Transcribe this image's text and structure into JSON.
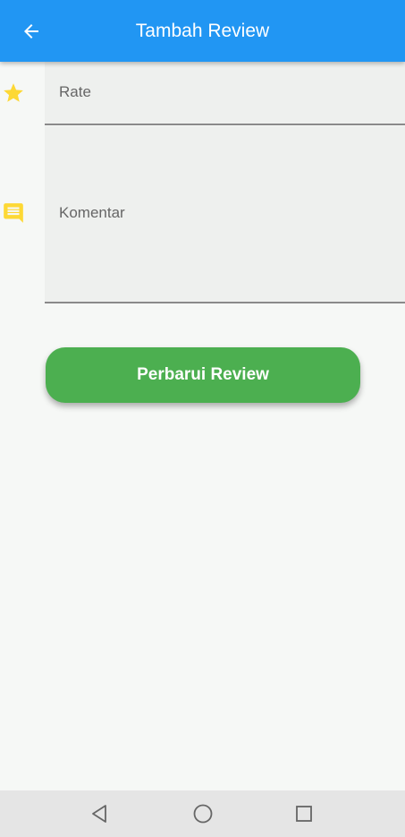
{
  "appbar": {
    "title": "Tambah Review",
    "back_icon": "arrow-back-icon",
    "color": "#2196f3"
  },
  "form": {
    "rate": {
      "label": "Rate",
      "icon": "star-icon"
    },
    "comment": {
      "label": "Komentar",
      "icon": "comment-icon"
    },
    "icon_color": "#fdd835"
  },
  "submit": {
    "label": "Perbarui Review",
    "color": "#4caf50"
  },
  "navbar": {
    "buttons": [
      "back-triangle-icon",
      "home-circle-icon",
      "recents-square-icon"
    ]
  }
}
